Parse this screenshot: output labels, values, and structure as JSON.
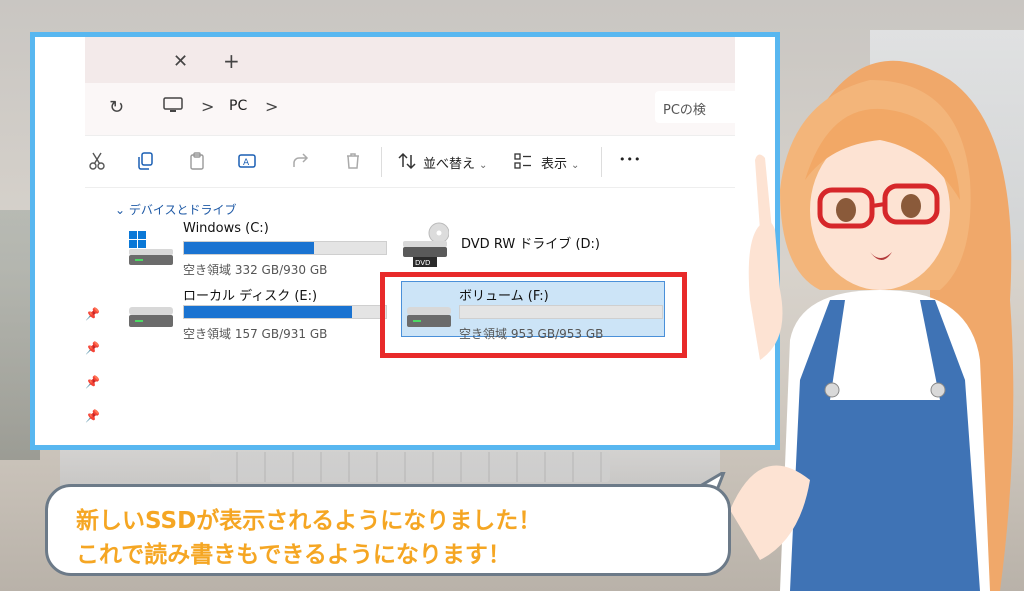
{
  "tabbar": {
    "close_glyph": "✕",
    "add_glyph": "+"
  },
  "address": {
    "refresh_glyph": "↻",
    "breadcrumb_sep": ">",
    "crumb": "PC",
    "search_placeholder": "PCの検"
  },
  "toolbar": {
    "icons": [
      "cut-icon",
      "copy-icon",
      "paste-icon",
      "rename-icon",
      "share-icon",
      "delete-icon"
    ],
    "sort_label": "並べ替え",
    "view_label": "表示",
    "more_glyph": "•••"
  },
  "group": {
    "header": "デバイスとドライブ"
  },
  "drives": [
    {
      "name": "Windows (C:)",
      "space": "空き領域 332 GB/930 GB",
      "used_fraction": 0.643
    },
    {
      "name": "DVD RW ドライブ (D:)",
      "label": "DVD"
    },
    {
      "name": "ローカル ディスク (E:)",
      "space": "空き領域 157 GB/931 GB",
      "used_fraction": 0.831
    },
    {
      "name": "ボリューム (F:)",
      "space": "空き領域 953 GB/953 GB",
      "used_fraction": 0.0
    }
  ],
  "bubble": {
    "line1": "新しいSSDが表示されるようになりました！",
    "line2": "これで読み書きもできるようになります！"
  },
  "colors": {
    "frame": "#58b7f0",
    "highlight": "#e82a2a",
    "bar": "#1a73d1",
    "bubble_text": "#f5a623"
  }
}
